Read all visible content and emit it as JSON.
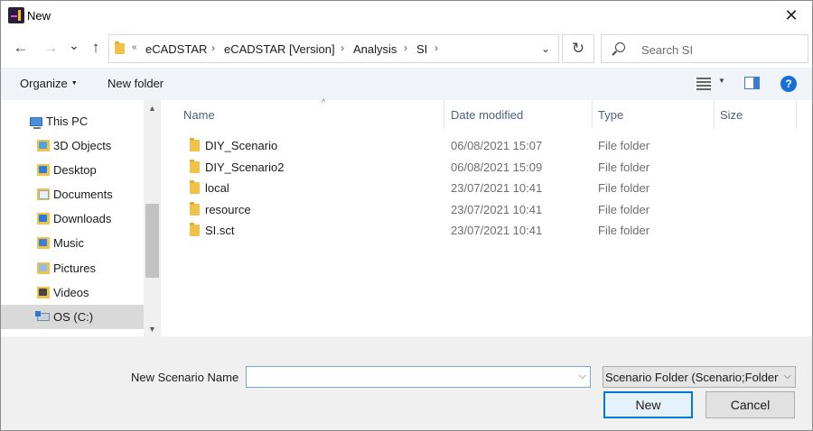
{
  "window": {
    "title": "New",
    "icon": "ecadstar-app-icon",
    "close_glyph": "✕"
  },
  "navigation": {
    "back_glyph": "←",
    "forward_glyph": "→",
    "recent_glyph": "⌄",
    "up_glyph": "↑",
    "refresh_glyph": "↻"
  },
  "address_bar": {
    "overflow": "«",
    "segments": [
      "eCADSTAR",
      "eCADSTAR [Version]",
      "Analysis",
      "SI"
    ],
    "separator": "›",
    "dropdown_glyph": "⌄"
  },
  "search": {
    "placeholder": "Search SI",
    "value": ""
  },
  "toolbar": {
    "organize_label": "Organize",
    "new_folder_label": "New folder",
    "help_glyph": "?"
  },
  "nav_pane": {
    "items": [
      {
        "label": "This PC",
        "icon": "computer-icon"
      },
      {
        "label": "3D Objects",
        "icon": "3d-objects-folder-icon"
      },
      {
        "label": "Desktop",
        "icon": "desktop-folder-icon"
      },
      {
        "label": "Documents",
        "icon": "documents-folder-icon"
      },
      {
        "label": "Downloads",
        "icon": "downloads-folder-icon"
      },
      {
        "label": "Music",
        "icon": "music-folder-icon"
      },
      {
        "label": "Pictures",
        "icon": "pictures-folder-icon"
      },
      {
        "label": "Videos",
        "icon": "videos-folder-icon"
      },
      {
        "label": "OS (C:)",
        "icon": "drive-icon",
        "selected": true
      }
    ]
  },
  "file_list": {
    "columns": [
      "Name",
      "Date modified",
      "Type",
      "Size"
    ],
    "sort_glyph": "^",
    "rows": [
      {
        "name": "DIY_Scenario",
        "date": "06/08/2021 15:07",
        "type": "File folder",
        "size": ""
      },
      {
        "name": "DIY_Scenario2",
        "date": "06/08/2021 15:09",
        "type": "File folder",
        "size": ""
      },
      {
        "name": "local",
        "date": "23/07/2021 10:41",
        "type": "File folder",
        "size": ""
      },
      {
        "name": "resource",
        "date": "23/07/2021 10:41",
        "type": "File folder",
        "size": ""
      },
      {
        "name": "SI.sct",
        "date": "23/07/2021 10:41",
        "type": "File folder",
        "size": ""
      }
    ]
  },
  "footer": {
    "name_label": "New Scenario Name",
    "name_value": "",
    "filter_value": "Scenario Folder (Scenario;Folder",
    "primary_button": "New",
    "cancel_button": "Cancel"
  },
  "colors": {
    "accent": "#0078d7",
    "folder": "#f0c248",
    "toolbar_bg": "#f0f4f9",
    "selection": "#d9d9d9"
  }
}
